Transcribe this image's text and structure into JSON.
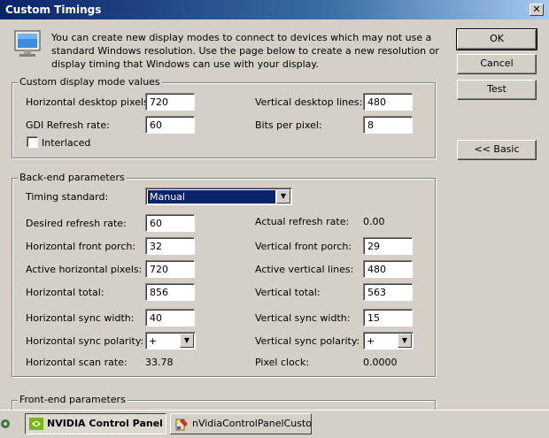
{
  "window": {
    "title": "Custom Timings",
    "close_glyph": "✕"
  },
  "intro": "You can create new display modes to connect to devices which may not use a standard Windows resolution. Use the page below to create a new resolution or display timing that Windows can use with your display.",
  "buttons": {
    "ok": "OK",
    "cancel": "Cancel",
    "test": "Test",
    "basic": "<< Basic"
  },
  "custom_mode": {
    "title": "Custom display mode values",
    "h_pixels": {
      "label": "Horizontal desktop pixels:",
      "value": "720"
    },
    "v_lines": {
      "label": "Vertical desktop lines:",
      "value": "480"
    },
    "gdi_refresh": {
      "label": "GDI Refresh rate:",
      "value": "60"
    },
    "bpp": {
      "label": "Bits per pixel:",
      "value": "8"
    },
    "interlaced": {
      "label": "Interlaced",
      "checked": false
    }
  },
  "backend": {
    "title": "Back-end parameters",
    "timing_standard": {
      "label": "Timing standard:",
      "value": "Manual"
    },
    "desired_refresh": {
      "label": "Desired refresh rate:",
      "value": "60"
    },
    "actual_refresh": {
      "label": "Actual refresh rate:",
      "value": "0.00"
    },
    "h_front_porch": {
      "label": "Horizontal front porch:",
      "value": "32"
    },
    "v_front_porch": {
      "label": "Vertical front porch:",
      "value": "29"
    },
    "active_h": {
      "label": "Active horizontal pixels:",
      "value": "720"
    },
    "active_v": {
      "label": "Active vertical lines:",
      "value": "480"
    },
    "h_total": {
      "label": "Horizontal total:",
      "value": "856"
    },
    "v_total": {
      "label": "Vertical total:",
      "value": "563"
    },
    "h_sync_width": {
      "label": "Horizontal sync width:",
      "value": "40"
    },
    "v_sync_width": {
      "label": "Vertical sync width:",
      "value": "15"
    },
    "h_sync_polarity": {
      "label": "Horizontal sync polarity:",
      "value": "+"
    },
    "v_sync_polarity": {
      "label": "Vertical sync polarity:",
      "value": "+"
    },
    "h_scan_rate": {
      "label": "Horizontal scan rate:",
      "value": "33.78"
    },
    "pixel_clock": {
      "label": "Pixel clock:",
      "value": "0.0000"
    }
  },
  "frontend": {
    "title": "Front-end parameters"
  },
  "taskbar": {
    "items": [
      {
        "label": "NVIDIA Control Panel",
        "icon": "nvidia-icon",
        "active": true
      },
      {
        "label": "nVidiaControlPanelCusto...",
        "icon": "paint-icon",
        "active": false
      }
    ]
  },
  "colors": {
    "titlebar": "#0a246a",
    "face": "#d4d0c8",
    "selection": "#0a246a"
  }
}
